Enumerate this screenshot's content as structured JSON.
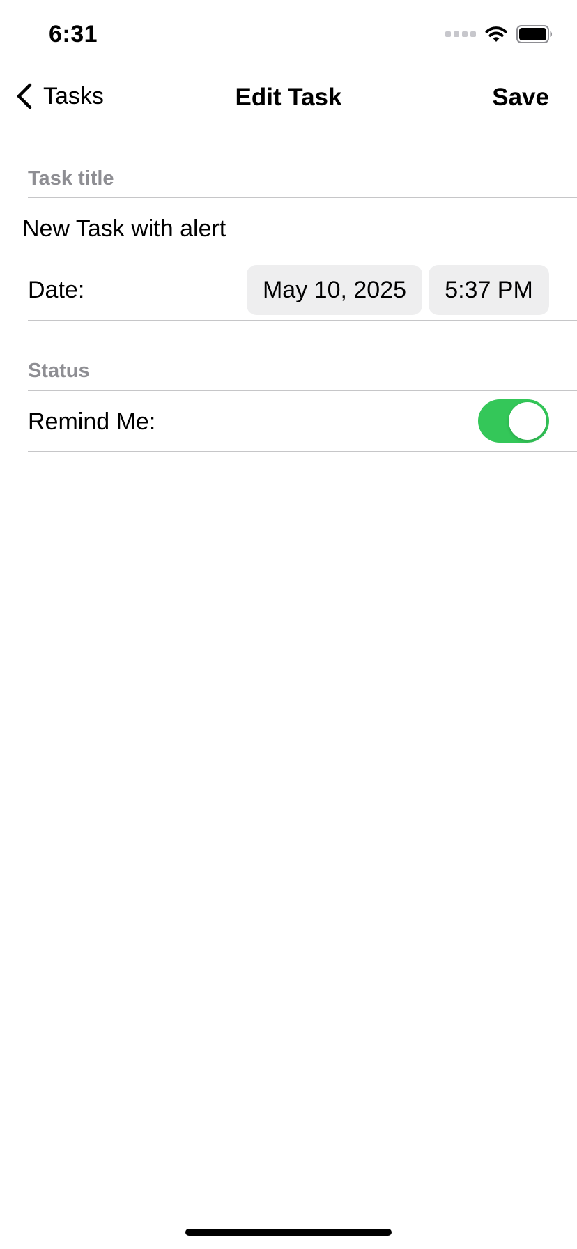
{
  "status_bar": {
    "time": "6:31",
    "icons": [
      "cellular-signal-icon",
      "wifi-icon",
      "battery-icon"
    ]
  },
  "nav": {
    "back_label": "Tasks",
    "title": "Edit Task",
    "save_label": "Save",
    "back_icon": "chevron-left-icon"
  },
  "form": {
    "task_title_header": "Task title",
    "task_title_value": "New Task with alert",
    "date_label": "Date:",
    "date_value": "May 10, 2025",
    "time_value": "5:37 PM",
    "status_header": "Status",
    "remind_label": "Remind Me:",
    "remind_on": true
  },
  "colors": {
    "toggle_on": "#34c759",
    "section_header": "#8e8e93",
    "pill_background": "#eeeeef",
    "divider": "#c6c6c8"
  }
}
